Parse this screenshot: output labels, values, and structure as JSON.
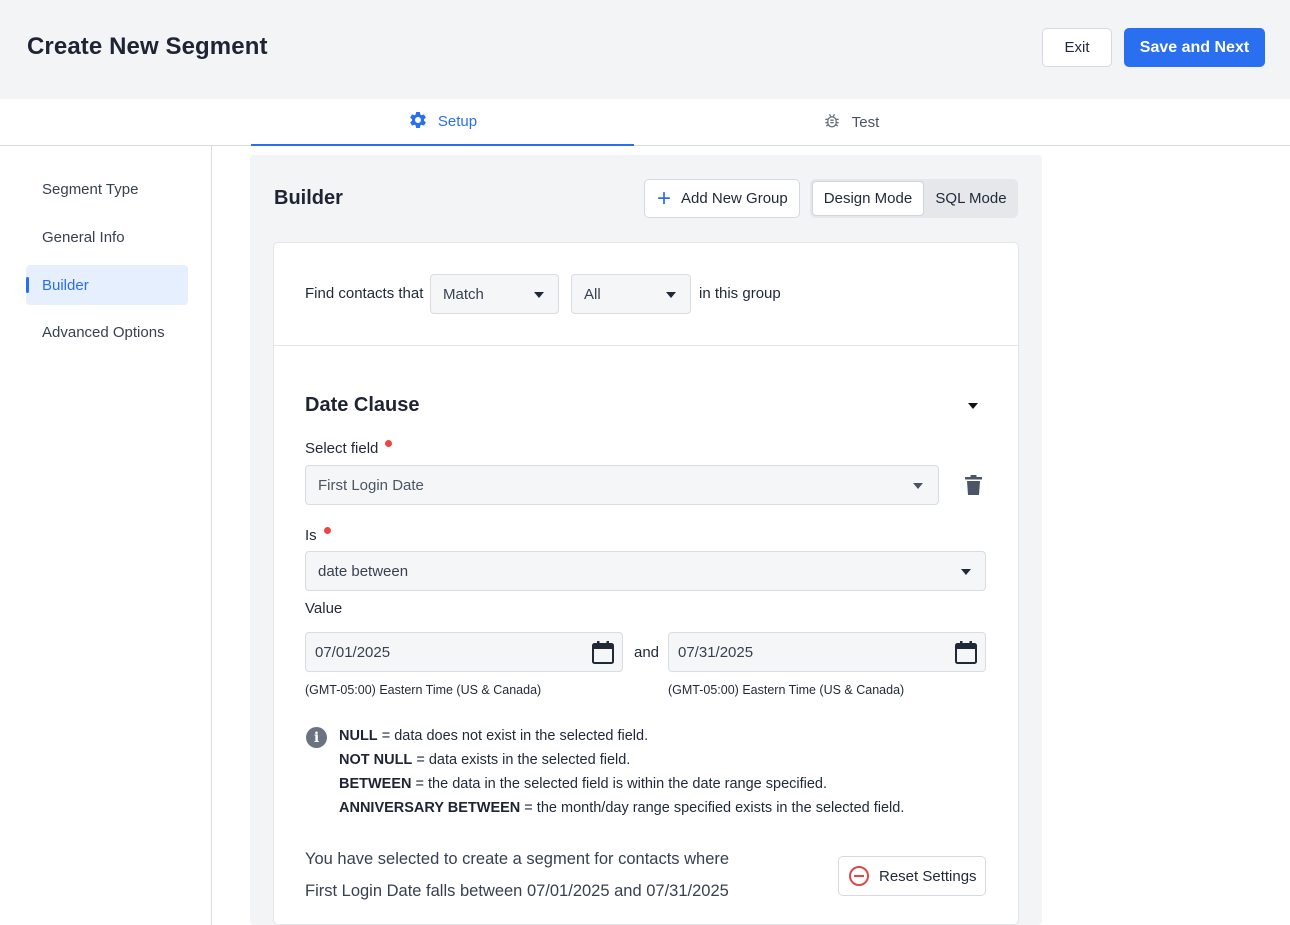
{
  "header": {
    "title": "Create New Segment",
    "exit_label": "Exit",
    "save_label": "Save and Next"
  },
  "tabs": [
    {
      "label": "Setup",
      "icon": "gear-icon",
      "active": true
    },
    {
      "label": "Test",
      "icon": "bug-icon",
      "active": false
    }
  ],
  "sidebar": {
    "items": [
      {
        "label": "Segment Type",
        "active": false
      },
      {
        "label": "General Info",
        "active": false
      },
      {
        "label": "Builder",
        "active": true
      },
      {
        "label": "Advanced Options",
        "active": false
      }
    ]
  },
  "builder": {
    "title": "Builder",
    "add_group_label": "Add New Group",
    "modes": {
      "design": "Design Mode",
      "sql": "SQL Mode",
      "selected": "Design Mode"
    },
    "find_label": "Find contacts that",
    "match_value": "Match",
    "scope_value": "All",
    "in_group_label": "in this group"
  },
  "clause": {
    "title": "Date Clause",
    "select_field_label": "Select field",
    "select_field_value": "First Login Date",
    "is_label": "Is",
    "is_value": "date between",
    "value_label": "Value",
    "start_date": "07/01/2025",
    "and_label": "and",
    "end_date": "07/31/2025",
    "timezone_start": "(GMT-05:00) Eastern Time (US & Canada)",
    "timezone_end": "(GMT-05:00) Eastern Time (US & Canada)"
  },
  "info": {
    "lines": [
      {
        "term": "NULL",
        "desc": " = data does not exist in the selected field."
      },
      {
        "term": "NOT NULL",
        "desc": " = data exists in the selected field."
      },
      {
        "term": "BETWEEN",
        "desc": " = the data in the selected field is within the date range specified."
      },
      {
        "term": "ANNIVERSARY BETWEEN",
        "desc": " = the month/day range specified exists in the selected field."
      }
    ]
  },
  "summary": {
    "line1": "You have selected to create a segment for contacts where",
    "line2": "First Login Date falls between 07/01/2025 and 07/31/2025",
    "reset_label": "Reset Settings"
  },
  "colors": {
    "accent": "#2a6ff0",
    "required": "#ef4444",
    "reset": "#e04848"
  }
}
